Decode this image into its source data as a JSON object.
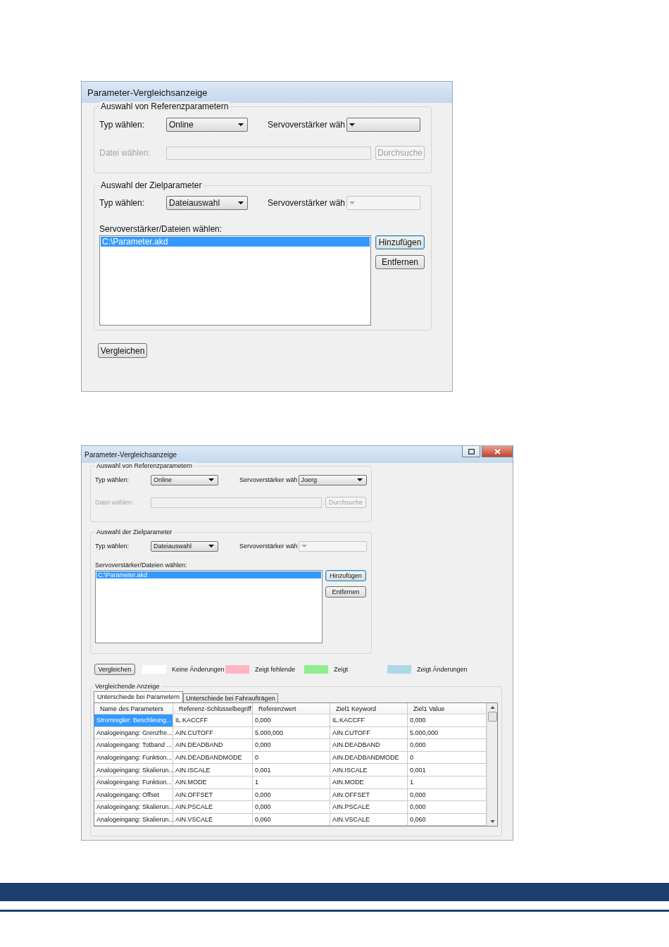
{
  "dialogs": [
    {
      "title": "Parameter-Vergleichsanzeige",
      "window_controls": false,
      "reference": {
        "legend": "Auswahl von Referenzparametern",
        "type_label": "Typ wählen:",
        "type_value": "Online",
        "drive_label": "Servoverstärker wäh",
        "file_label": "Datei wählen:",
        "file_disabled": true,
        "browse": "Durchsuche"
      },
      "target": {
        "legend": "Auswahl der Zielparameter",
        "type_label": "Typ wählen:",
        "type_value": "Dateiauswahl",
        "drive_label": "Servoverstärker wäh",
        "drive_disabled": true,
        "list_label": "Servoverstärker/Dateien wählen:",
        "files": [
          {
            "label": "C:\\Parameter.akd",
            "selected": true
          }
        ],
        "add": "Hinzufügen",
        "remove": "Entfernen"
      },
      "compare_button": "Vergleichen"
    },
    {
      "title": "Parameter-Vergleichsanzeige",
      "window_controls": true,
      "reference": {
        "legend": "Auswahl von Referenzparametern",
        "type_label": "Typ wählen:",
        "type_value": "Online",
        "drive_label": "Servoverstärker wäh",
        "drive_value": "Joerg",
        "file_label": "Datei wählen:",
        "file_disabled": true,
        "browse": "Durchsuche"
      },
      "target": {
        "legend": "Auswahl der Zielparameter",
        "type_label": "Typ wählen:",
        "type_value": "Dateiauswahl",
        "drive_label": "Servoverstärker wäh",
        "drive_disabled": true,
        "list_label": "Servoverstärker/Dateien wählen:",
        "files": [
          {
            "label": "C:\\Parameter.akd",
            "selected": true
          }
        ],
        "add": "Hinzufügen",
        "remove": "Entfernen"
      },
      "compare_button": "Vergleichen",
      "legend": [
        {
          "label": "Keine Änderungen",
          "color": "#ffffff"
        },
        {
          "label": "Zeigt fehlende",
          "color": "#ffb6c1"
        },
        {
          "label": "Zeigt",
          "color": "#90ee90"
        },
        {
          "label": "Zeigt Änderungen",
          "color": "#add8e6"
        }
      ],
      "results": {
        "legend": "Vergleichende Anzeige",
        "tabs": [
          {
            "label": "Unterschiede bei Parametern",
            "selected": true
          },
          {
            "label": "Unterschiede bei Fahraufträgen",
            "selected": false
          }
        ],
        "columns": [
          "Name des Parameters",
          "Referenz-Schlüsselbegriff",
          "Referenzwert",
          "Ziel1 Keyword",
          "Ziel1 Value"
        ],
        "rows": [
          {
            "cells": [
              "Stromregler: Beschleung...",
              "IL.KACCFF",
              "0,000",
              "IL.KACCFF",
              "0,000"
            ],
            "selected": true
          },
          {
            "cells": [
              "Analogeingang: Grenzfre...",
              "AIN.CUTOFF",
              "5.000,000",
              "AIN.CUTOFF",
              "5.000,000"
            ],
            "selected": false
          },
          {
            "cells": [
              "Analogeingang: Totband ...",
              "AIN.DEADBAND",
              "0,000",
              "AIN.DEADBAND",
              "0,000"
            ],
            "selected": false
          },
          {
            "cells": [
              "Analogeingang: Funktion...",
              "AIN.DEADBANDMODE",
              "0",
              "AIN.DEADBANDMODE",
              "0"
            ],
            "selected": false
          },
          {
            "cells": [
              "Analogeingang: Skalierun...",
              "AIN.ISCALE",
              "0,001",
              "AIN.ISCALE",
              "0,001"
            ],
            "selected": false
          },
          {
            "cells": [
              "Analogeingang: Funktion...",
              "AIN.MODE",
              "1",
              "AIN.MODE",
              "1"
            ],
            "selected": false
          },
          {
            "cells": [
              "Analogeingang: Offset",
              "AIN.OFFSET",
              "0,000",
              "AIN.OFFSET",
              "0,000"
            ],
            "selected": false
          },
          {
            "cells": [
              "Analogeingang: Skalierun...",
              "AIN.PSCALE",
              "0,000",
              "AIN.PSCALE",
              "0,000"
            ],
            "selected": false
          },
          {
            "cells": [
              "Analogeingang: Skalierun...",
              "AIN.VSCALE",
              "0,060",
              "AIN.VSCALE",
              "0,060"
            ],
            "selected": false
          }
        ]
      }
    }
  ]
}
